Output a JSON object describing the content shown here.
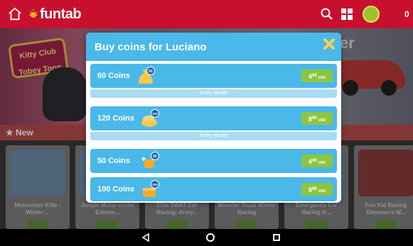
{
  "app": {
    "logo_text": "funtab",
    "coin_count": "0"
  },
  "banner": {
    "badge_line1": "Kitty Club",
    "badge_line2": "Tobey Toon",
    "right_text": "er"
  },
  "section": {
    "new_label": "New"
  },
  "games": [
    {
      "name": "Motocross Kids - Winter ..."
    },
    {
      "name": "Jungle Motor-cross Extrem..."
    },
    {
      "name": "Elite SWAT Car Racing: Army..."
    },
    {
      "name": "Monster Truck Winter Racing"
    },
    {
      "name": "Emergency Car Racing H..."
    },
    {
      "name": "Fun Kid Racing Dinosaurs W..."
    }
  ],
  "modal": {
    "title": "Buy coins for  Luciano",
    "offers": [
      {
        "label": "60 Coins",
        "badge": "60",
        "price_main": "4",
        "price_sup": "99",
        "currency": "USD",
        "subtitle": "Every Month"
      },
      {
        "label": "120 Coins",
        "badge": "120",
        "price_main": "8",
        "price_sup": "99",
        "currency": "USD",
        "subtitle": "Every Month"
      },
      {
        "label": "50 Coins",
        "badge": "50",
        "price_main": "4",
        "price_sup": "99",
        "currency": "USD",
        "subtitle": ""
      },
      {
        "label": "100 Coins",
        "badge": "100",
        "price_main": "8",
        "price_sup": "99",
        "currency": "USD",
        "subtitle": ""
      }
    ]
  },
  "colors": {
    "topbar": "#c8102e",
    "modal_blue": "#4ab8e8",
    "price_green": "#8cc63f",
    "subscription_strip": "#a7dcf3"
  },
  "icons": [
    "home-icon",
    "search-icon",
    "grid-icon",
    "coin-icon",
    "close-icon",
    "coin-bag-icon",
    "back-icon",
    "home-nav-icon",
    "recents-icon"
  ]
}
